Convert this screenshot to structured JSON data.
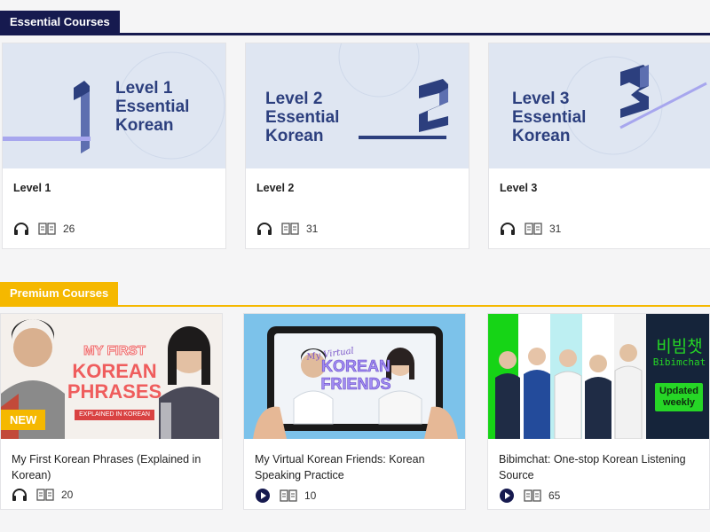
{
  "essential": {
    "heading": "Essential Courses",
    "courses": [
      {
        "title": "Level 1",
        "thumb_text": [
          "Level 1",
          "Essential",
          "Korean"
        ],
        "count": "26",
        "audio_icon": "headphones-icon",
        "book_icon": "book-icon"
      },
      {
        "title": "Level 2",
        "thumb_text": [
          "Level 2",
          "Essential",
          "Korean"
        ],
        "count": "31",
        "audio_icon": "headphones-icon",
        "book_icon": "book-icon"
      },
      {
        "title": "Level 3",
        "thumb_text": [
          "Level 3",
          "Essential",
          "Korean"
        ],
        "count": "31",
        "audio_icon": "headphones-icon",
        "book_icon": "book-icon"
      }
    ]
  },
  "premium": {
    "heading": "Premium Courses",
    "courses": [
      {
        "title": "My First Korean Phrases (Explained in Korean)",
        "count": "20",
        "media_icon": "headphones-icon",
        "thumb": {
          "line1": "MY FIRST",
          "line2": "KOREAN",
          "line3": "PHRASES",
          "sub": "EXPLAINED IN KOREAN",
          "badge": "NEW"
        }
      },
      {
        "title": "My Virtual Korean Friends: Korean Speaking Practice",
        "count": "10",
        "media_icon": "play-icon",
        "thumb": {
          "script": "My Virtual",
          "line1": "KOREAN",
          "line2": "FRIENDS"
        }
      },
      {
        "title": "Bibimchat: One-stop Korean Listening Source",
        "count": "65",
        "media_icon": "play-icon",
        "thumb": {
          "logo": "비빔챗",
          "logo_sub": "Bibimchat",
          "badge": "Updated weekly"
        }
      }
    ]
  },
  "colors": {
    "navy": "#161a4f",
    "gold": "#f5b800",
    "level_text": "#2c3f7e",
    "thumb_bg": "#dfe6f2"
  }
}
